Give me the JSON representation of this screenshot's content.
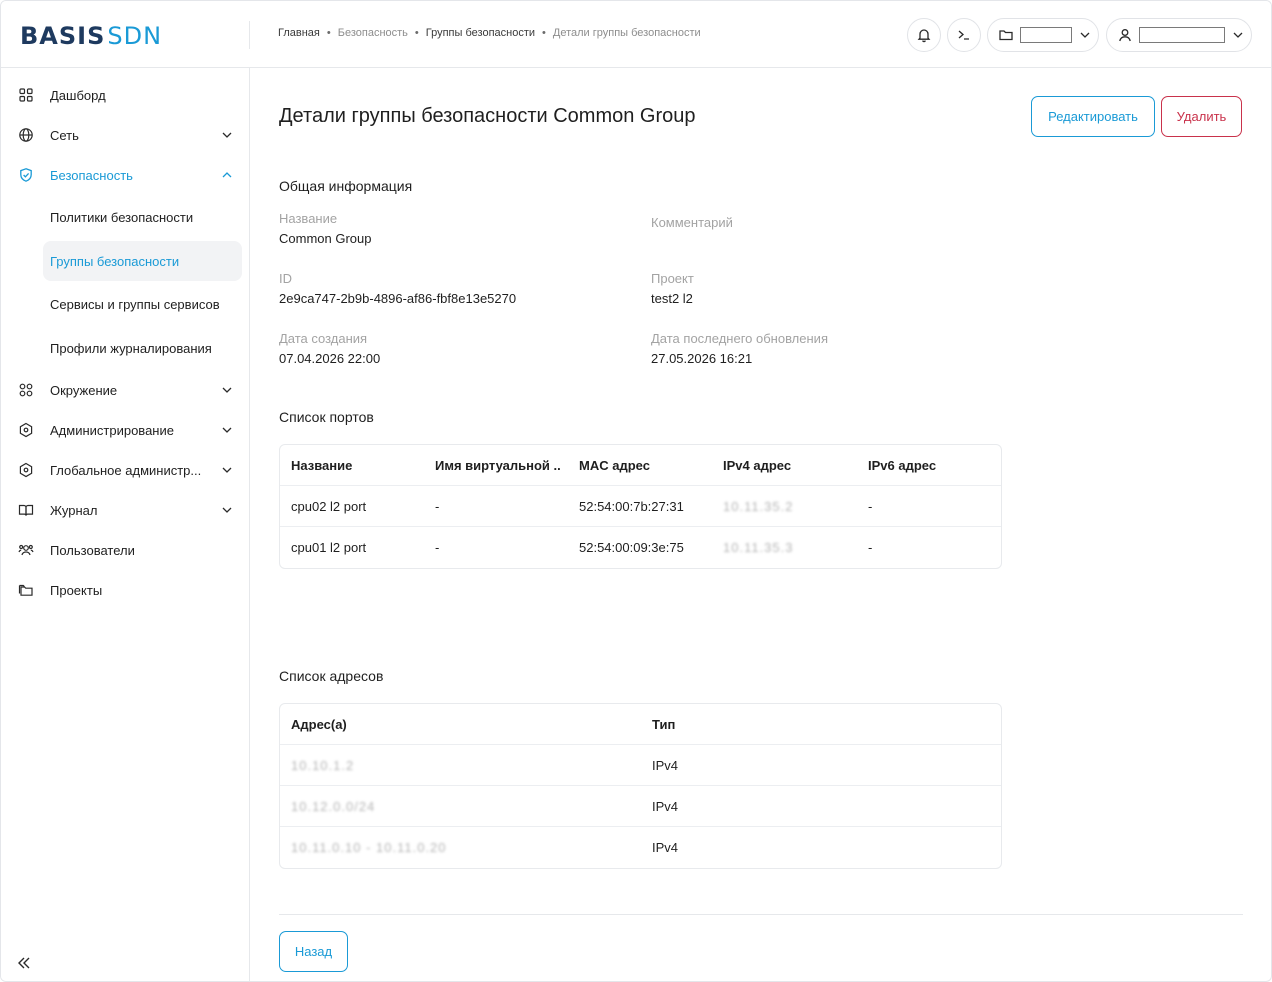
{
  "brand": {
    "part1": "BASIS",
    "part2": "SDN",
    "accent": "#1a9ad6",
    "dark": "#1e3a5f"
  },
  "breadcrumb": [
    "Главная",
    "Безопасность",
    "Группы безопасности",
    "Детали группы безопасности"
  ],
  "header_icons": [
    "bell-icon",
    "terminal-icon",
    "folder-icon",
    "user-icon"
  ],
  "sidebar": {
    "items": [
      {
        "label": "Дашборд",
        "icon": "grid-icon",
        "has_chevron": false
      },
      {
        "label": "Сеть",
        "icon": "globe-icon",
        "has_chevron": true
      },
      {
        "label": "Безопасность",
        "icon": "shield-icon",
        "has_chevron": true,
        "expanded": true,
        "active": true
      },
      {
        "label": "Окружение",
        "icon": "grid-icon",
        "has_chevron": true
      },
      {
        "label": "Администрирование",
        "icon": "hexagon-icon",
        "has_chevron": true
      },
      {
        "label": "Глобальное администр...",
        "icon": "hexagon-icon",
        "has_chevron": true
      },
      {
        "label": "Журнал",
        "icon": "book-icon",
        "has_chevron": true
      },
      {
        "label": "Пользователи",
        "icon": "users-icon",
        "has_chevron": false
      },
      {
        "label": "Проекты",
        "icon": "folders-icon",
        "has_chevron": false
      }
    ],
    "sub_items": [
      {
        "label": "Политики безопасности",
        "selected": false
      },
      {
        "label": "Группы безопасности",
        "selected": true
      },
      {
        "label": "Сервисы и группы сервисов",
        "selected": false
      },
      {
        "label": "Профили журналирования",
        "selected": false
      }
    ]
  },
  "page": {
    "title": "Детали группы безопасности Common Group",
    "edit_label": "Редактировать",
    "delete_label": "Удалить",
    "back_label": "Назад"
  },
  "general": {
    "section_title": "Общая информация",
    "name_label": "Название",
    "name_value": "Common Group",
    "comment_label": "Комментарий",
    "id_label": "ID",
    "id_value": "2e9ca747-2b9b-4896-af86-fbf8e13e5270",
    "project_label": "Проект",
    "project_value": "test2 l2",
    "created_label": "Дата создания",
    "created_value": "07.04.2026 22:00",
    "updated_label": "Дата последнего обновления",
    "updated_value": "27.05.2026 16:21"
  },
  "ports": {
    "section_title": "Список портов",
    "columns": [
      "Название",
      "Имя виртуальной ...",
      "MAC адрес",
      "IPv4 адрес",
      "IPv6 адрес"
    ],
    "rows": [
      [
        "cpu02 l2 port",
        "-",
        "52:54:00:7b:27:31",
        "10.11.35.2",
        "-"
      ],
      [
        "cpu01 l2 port",
        "-",
        "52:54:00:09:3e:75",
        "10.11.35.3",
        "-"
      ]
    ]
  },
  "addresses": {
    "section_title": "Список адресов",
    "columns": [
      "Адрес(а)",
      "Тип"
    ],
    "rows": [
      [
        "10.10.1.2",
        "IPv4"
      ],
      [
        "10.12.0.0/24",
        "IPv4"
      ],
      [
        "10.11.0.10 - 10.11.0.20",
        "IPv4"
      ]
    ]
  }
}
